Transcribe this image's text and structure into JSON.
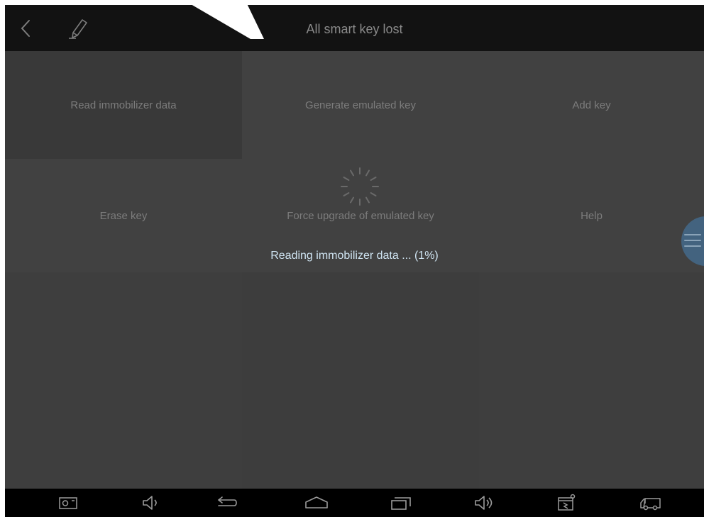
{
  "header": {
    "title": "All smart key lost",
    "back_icon": "chevron-left-icon",
    "edit_icon": "pencil-icon"
  },
  "functions": [
    {
      "label": "Read immobilizer data"
    },
    {
      "label": "Generate emulated key"
    },
    {
      "label": "Add key"
    },
    {
      "label": "Erase key"
    },
    {
      "label": "Force upgrade of emulated key"
    },
    {
      "label": "Help"
    }
  ],
  "loading": {
    "message": "Reading immobilizer data ... (1%)",
    "progress_percent": 1
  },
  "navbar": {
    "icons": [
      "screenshot-icon",
      "volume-down-icon",
      "back-icon",
      "home-icon",
      "recent-apps-icon",
      "volume-up-icon",
      "vci-icon",
      "truck-icon"
    ]
  },
  "colors": {
    "topbar": "#121212",
    "content": "#414141",
    "overlay_text": "#cfe4f2",
    "float_menu": "#43637f"
  }
}
